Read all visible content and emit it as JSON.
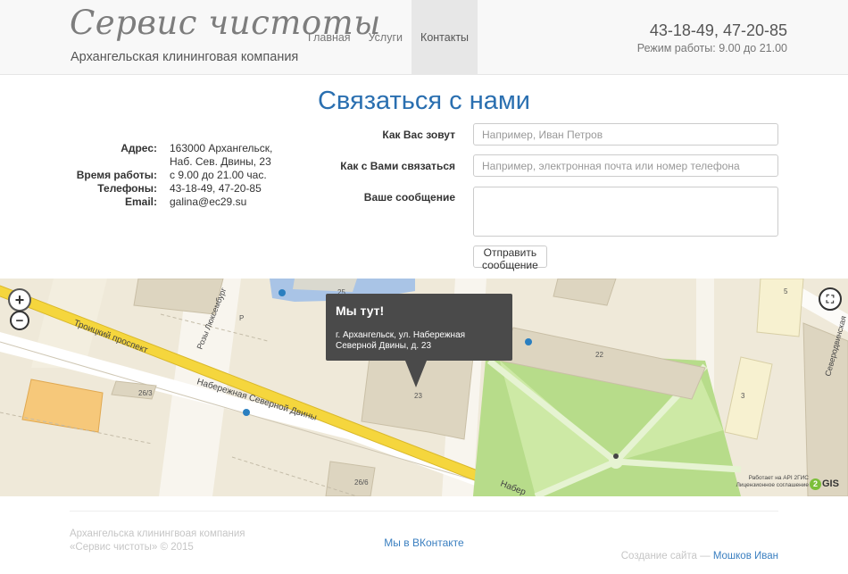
{
  "header": {
    "logo": "Сервис чистоты",
    "tagline": "Архангельская клининговая компания",
    "nav": [
      {
        "label": "Главная"
      },
      {
        "label": "Услуги"
      },
      {
        "label": "Контакты"
      }
    ],
    "phones": "43-18-49, 47-20-85",
    "hours": "Режим работы: 9.00 до 21.00"
  },
  "page_title": "Связаться с нами",
  "address": {
    "rows": [
      {
        "label": "Адрес:",
        "value": "163000 Архангельск,"
      },
      {
        "label": "",
        "value": "Наб. Сев. Двины, 23"
      },
      {
        "label": "Время работы:",
        "value": "с 9.00 до 21.00 час."
      },
      {
        "label": "Телефоны:",
        "value": "43-18-49, 47-20-85"
      },
      {
        "label": "Email:",
        "value": "galina@ec29.su"
      }
    ]
  },
  "form": {
    "name_label": "Как Вас зовут",
    "name_placeholder": "Например, Иван Петров",
    "contact_label": "Как с Вами связаться",
    "contact_placeholder": "Например, электронная почта или номер телефона",
    "message_label": "Ваше сообщение",
    "submit_label": "Отправить сообщение"
  },
  "map": {
    "zoom_in": "+",
    "zoom_out": "−",
    "fullscreen": "⛶",
    "popup_title": "Мы тут!",
    "popup_text": "г. Архангельск, ул. Набережная Северной Двины, д. 23",
    "labels": {
      "troitsky": "Троицкий проспект",
      "naberezhnaya": "Набережная Северной Двины",
      "naberezhnaya2": "Набер",
      "rozy": "Розы Люксембург",
      "severodvinskaya": "Северодвинская",
      "b25": "25",
      "b22": "22",
      "b23": "23",
      "b26_3": "26/3",
      "b26_6": "26/6",
      "b5": "5",
      "b3": "3",
      "parking": "P"
    },
    "attribution_1": "Работает на API 2ГИС",
    "attribution_2": "Лицензионное соглашение",
    "logo": "GIS",
    "logo_digit": "2"
  },
  "footer": {
    "left_1": "Архангельска клинингвоая компания",
    "left_2": "«Сервис чистоты» © 2015",
    "vk_link": "Мы в ВКонтакте",
    "credit_prefix": "Создание сайта — ",
    "credit_name": "Мошков Иван"
  },
  "colors": {
    "accent": "#2a6fb0",
    "main_road": "#f5d63d",
    "park": "#b7dc8a",
    "building": "#ddd5c0"
  }
}
